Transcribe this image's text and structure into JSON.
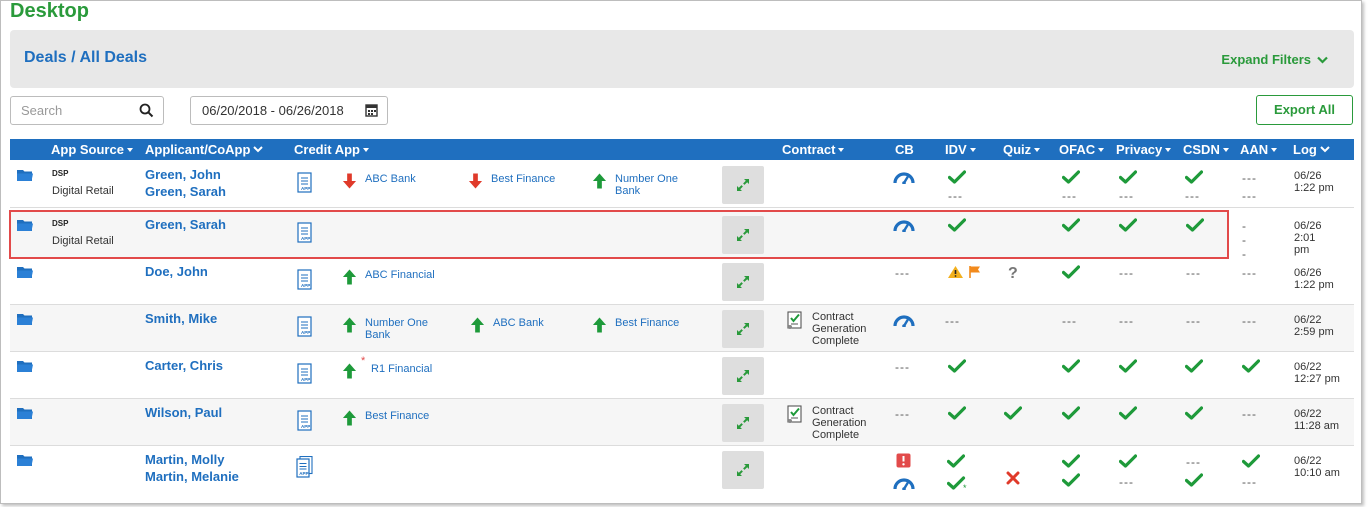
{
  "page": {
    "title": "Desktop"
  },
  "header": {
    "breadcrumb": "Deals / All Deals",
    "expand_filters": "Expand Filters"
  },
  "search": {
    "placeholder": "Search"
  },
  "date_range": {
    "value": "06/20/2018 - 06/26/2018"
  },
  "export": {
    "label": "Export All"
  },
  "colors": {
    "brand_green": "#2a9a3b",
    "link_blue": "#1f6fbf",
    "header_blue": "#1f6fbf",
    "alert_red": "#e24a4a",
    "warn_orange": "#f28a1c"
  },
  "columns": {
    "app_source": "App Source",
    "applicant": "Applicant/CoApp",
    "credit_app": "Credit App",
    "contract": "Contract",
    "cb": "CB",
    "idv": "IDV",
    "quiz": "Quiz",
    "ofac": "OFAC",
    "privacy": "Privacy",
    "csdn": "CSDN",
    "aan": "AAN",
    "log": "Log"
  },
  "rows": [
    {
      "source_tag": "DSP",
      "source": "Digital Retail",
      "applicant": "Green, John",
      "coapplicant": "Green, Sarah",
      "lenders": [
        {
          "name": "ABC Bank",
          "status": "down"
        },
        {
          "name": "Best Finance",
          "status": "down"
        },
        {
          "name": "Number One Bank",
          "status": "up"
        }
      ],
      "contract": "",
      "cb": "gauge-icon",
      "log_date": "06/26",
      "log_time": "1:22 pm"
    },
    {
      "source_tag": "DSP",
      "source": "Digital Retail",
      "applicant": "Green, Sarah",
      "coapplicant": "",
      "lenders": [],
      "contract": "",
      "cb": "gauge-icon",
      "log_date": "06/26",
      "log_time": "2:01 pm"
    },
    {
      "source_tag": "",
      "source": "",
      "applicant": "Doe, John",
      "coapplicant": "",
      "lenders": [
        {
          "name": "ABC Financial",
          "status": "up"
        }
      ],
      "contract": "",
      "log_date": "06/26",
      "log_time": "1:22 pm"
    },
    {
      "source_tag": "",
      "source": "",
      "applicant": "Smith, Mike",
      "coapplicant": "",
      "lenders": [
        {
          "name": "Number One Bank",
          "status": "up"
        },
        {
          "name": "ABC Bank",
          "status": "up"
        },
        {
          "name": "Best Finance",
          "status": "up"
        }
      ],
      "contract": "Contract Generation Complete",
      "log_date": "06/22",
      "log_time": "2:59 pm"
    },
    {
      "source_tag": "",
      "source": "",
      "applicant": "Carter, Chris",
      "coapplicant": "",
      "lenders": [
        {
          "name": "R1 Financial",
          "status": "up"
        }
      ],
      "contract": "",
      "log_date": "06/22",
      "log_time": "12:27 pm"
    },
    {
      "source_tag": "",
      "source": "",
      "applicant": "Wilson, Paul",
      "coapplicant": "",
      "lenders": [
        {
          "name": "Best Finance",
          "status": "up"
        }
      ],
      "contract": "Contract Generation Complete",
      "log_date": "06/22",
      "log_time": "11:28 am"
    },
    {
      "source_tag": "",
      "source": "",
      "applicant": "Martin, Molly",
      "coapplicant": "Martin, Melanie",
      "lenders": [],
      "contract": "",
      "log_date": "06/22",
      "log_time": "10:10 am"
    }
  ],
  "placeholders": {
    "dash": "---",
    "contract_line1": "Contract",
    "contract_line2": "Generation",
    "contract_line3": "Complete",
    "number_one_l1": "Number One",
    "number_one_l2": "Bank"
  }
}
